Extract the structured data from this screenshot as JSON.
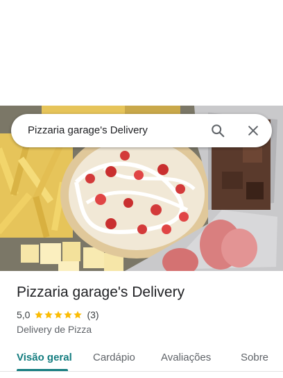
{
  "search": {
    "query": "Pizzaria garage's Delivery"
  },
  "place": {
    "name": "Pizzaria garage's Delivery",
    "rating": "5,0",
    "stars": 5,
    "review_count": "(3)",
    "category": "Delivery de Pizza"
  },
  "tabs": [
    {
      "label": "Visão geral",
      "active": true
    },
    {
      "label": "Cardápio",
      "active": false
    },
    {
      "label": "Avaliações",
      "active": false
    },
    {
      "label": "Sobre",
      "active": false
    }
  ],
  "colors": {
    "accent": "#137c7f",
    "star": "#fbbc04"
  },
  "icons": [
    "search-icon",
    "close-icon",
    "star-icon"
  ]
}
